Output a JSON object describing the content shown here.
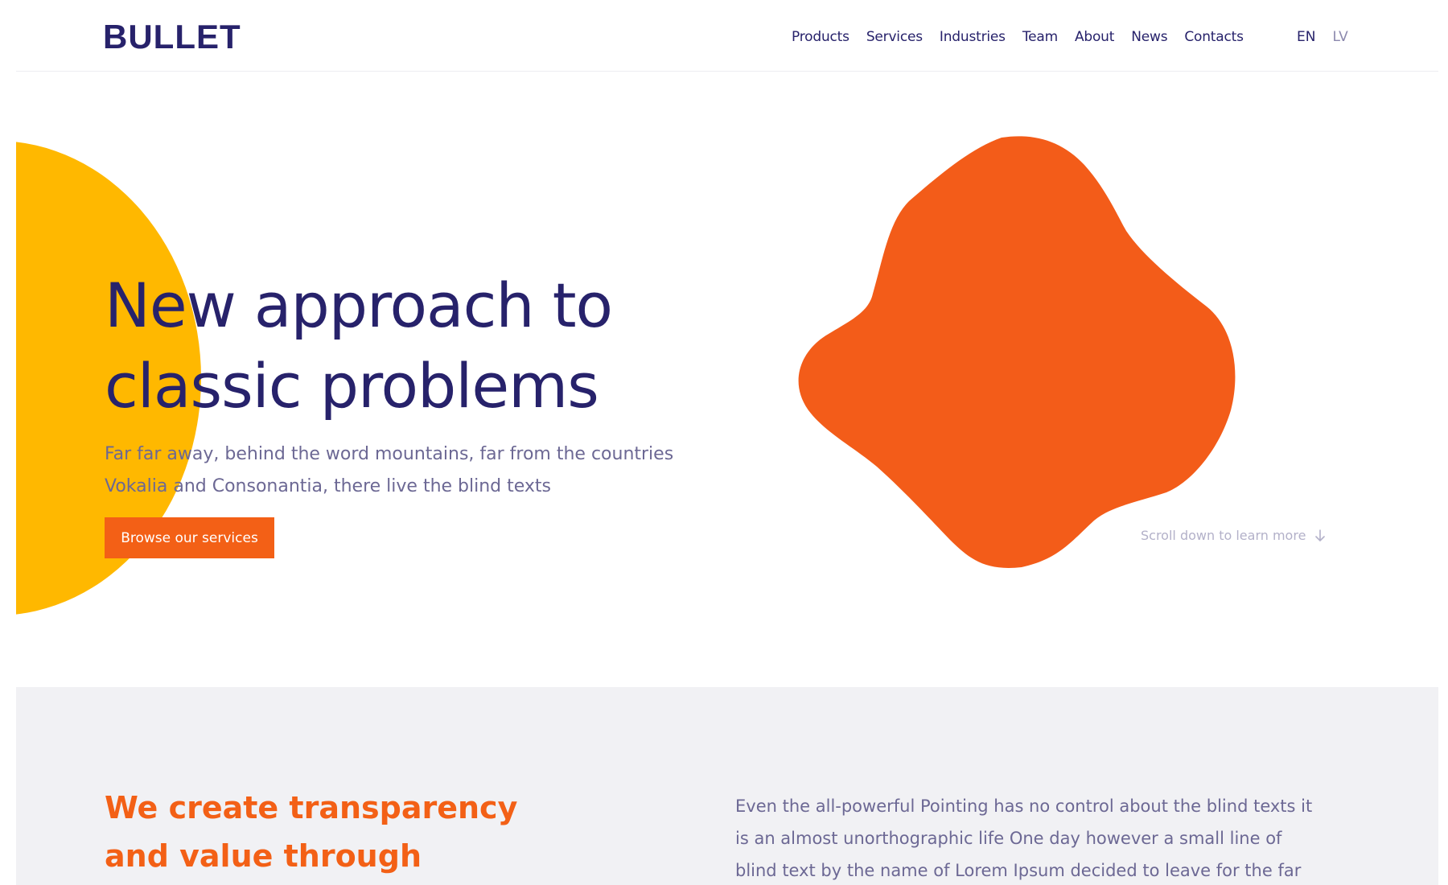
{
  "header": {
    "logo": "BULLET",
    "nav": [
      {
        "label": "Products"
      },
      {
        "label": "Services"
      },
      {
        "label": "Industries"
      },
      {
        "label": "Team"
      },
      {
        "label": "About"
      },
      {
        "label": "News"
      },
      {
        "label": "Contacts"
      }
    ],
    "languages": [
      {
        "label": "EN",
        "active": true
      },
      {
        "label": "LV",
        "active": false
      }
    ]
  },
  "hero": {
    "title_line1": "New approach to",
    "title_line2": "classic problems",
    "subtitle_line1": "Far far away, behind the word mountains, far from the countries",
    "subtitle_line2": "Vokalia and Consonantia, there live the blind texts",
    "cta_label": "Browse our services",
    "scroll_hint": "Scroll down to learn more",
    "scroll_icon": "arrow-down-icon"
  },
  "section": {
    "title_line1": "We create transparency",
    "title_line2": "and value through",
    "text_line1": "Even the all-powerful Pointing has no control about the blind texts it",
    "text_line2": "is an almost unorthographic life One day however a small line of",
    "text_line3": "blind text by the name of Lorem Ipsum decided to leave for the far"
  },
  "colors": {
    "brand_navy": "#27226b",
    "accent_orange": "#f36016",
    "accent_yellow": "#ffb800",
    "muted_text": "#6c6894",
    "section_bg": "#f1f1f4"
  }
}
